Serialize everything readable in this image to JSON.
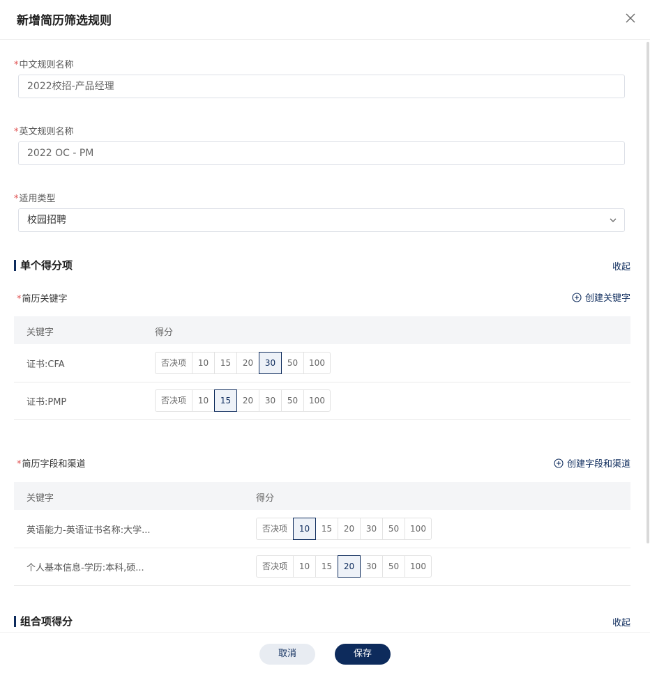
{
  "dialog": {
    "title": "新增简历筛选规则"
  },
  "form": {
    "cn_name": {
      "required_mark": "*",
      "label": "中文规则名称",
      "value": "2022校招-产品经理"
    },
    "en_name": {
      "required_mark": "*",
      "label": "英文规则名称",
      "value": "2022 OC - PM"
    },
    "type": {
      "required_mark": "*",
      "label": "适用类型",
      "value": "校园招聘"
    }
  },
  "single_section": {
    "title": "单个得分项",
    "collapse_label": "收起",
    "keywords": {
      "required_mark": "*",
      "label": "简历关键字",
      "create_label": "创建关键字",
      "columns": [
        "关键字",
        "得分"
      ],
      "rows": [
        {
          "keyword": "证书:CFA",
          "options": [
            "否决项",
            "10",
            "15",
            "20",
            "30",
            "50",
            "100"
          ],
          "selected": "30"
        },
        {
          "keyword": "证书:PMP",
          "options": [
            "否决项",
            "10",
            "15",
            "20",
            "30",
            "50",
            "100"
          ],
          "selected": "15"
        }
      ]
    },
    "fields": {
      "required_mark": "*",
      "label": "简历字段和渠道",
      "create_label": "创建字段和渠道",
      "columns": [
        "关键字",
        "得分"
      ],
      "rows": [
        {
          "keyword": "英语能力-英语证书名称:大学...",
          "options": [
            "否决项",
            "10",
            "15",
            "20",
            "30",
            "50",
            "100"
          ],
          "selected": "10"
        },
        {
          "keyword": "个人基本信息-学历:本科,硕...",
          "options": [
            "否决项",
            "10",
            "15",
            "20",
            "30",
            "50",
            "100"
          ],
          "selected": "20"
        }
      ]
    }
  },
  "combo_section": {
    "title": "组合项得分",
    "collapse_label": "收起"
  },
  "footer": {
    "cancel_label": "取消",
    "save_label": "保存"
  },
  "colors": {
    "primary": "#0d2b5c",
    "required": "#e05151",
    "cancel_bg": "#e8ecf2"
  },
  "icons": {
    "close": "close-icon",
    "chevron": "chevron-down-icon",
    "add": "plus-circle-icon"
  }
}
